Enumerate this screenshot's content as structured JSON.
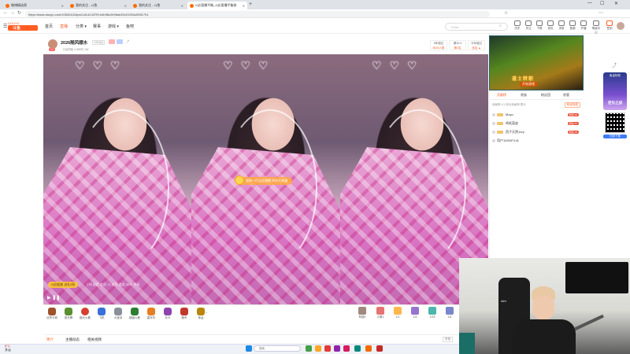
{
  "browser": {
    "tabs": [
      {
        "title": "微博精选视",
        "color": "#ff6a00",
        "active": false
      },
      {
        "title": "我的关注 - 斗鱼",
        "color": "#ff6a00",
        "active": false
      },
      {
        "title": "我的关注 - 斗鱼",
        "color": "#ff6a00",
        "active": false
      },
      {
        "title": "G必直播平衡_G必直播平衡收",
        "color": "#ff6a00",
        "active": true
      }
    ],
    "new_tab_label": "+",
    "window_controls": [
      "—",
      "☐",
      "✕"
    ],
    "url": "https://www.douyu.com/10542441#psCo8-d1437f9-b4b98c2b96ab92c01934c0051701"
  },
  "site": {
    "logo_text": "斗鱼",
    "nav": [
      "首页",
      "直播",
      "分类 ▾",
      "赛事",
      "游戏 ▾",
      "鱼吧"
    ],
    "search_placeholder": "+3 Ar/",
    "header_icons": [
      "历史",
      "关注",
      "下载",
      "钱包",
      "消息",
      "鱼圈",
      "开播",
      "等级中心",
      "签到"
    ]
  },
  "room": {
    "title": "2026随风顺水",
    "room_id": "1054[3]",
    "rank_badge": "14",
    "sub_info": "G必的娃 ▾   555万   1W",
    "stats": [
      {
        "label": "5年超过",
        "value": "8004人数"
      },
      {
        "label": "第33.3",
        "value": "第4名"
      },
      {
        "label": "今年超过",
        "value": "全站 ▲"
      }
    ]
  },
  "video": {
    "gift_message": "送你一打这礼物哦 你好大帅逼",
    "ticker_label": "G必超美 送礼5折",
    "ticker_text": "179 试用 会员 +1 试用 会员 20分 评论",
    "play_glyph": "▶ ❚❚"
  },
  "gifts": [
    {
      "name": "点赞卡券",
      "color": "#a0522d"
    },
    {
      "name": "荧光棒",
      "color": "#5b8f2f"
    },
    {
      "name": "超大火箭",
      "color": "#d4402f"
    },
    {
      "name": "飞机",
      "color": "#3a6ed8"
    },
    {
      "name": "大宝剑",
      "color": "#8a8f99"
    },
    {
      "name": "超级火箭",
      "color": "#2e7d32"
    },
    {
      "name": "嘉年华",
      "color": "#e67e22"
    },
    {
      "name": "办卡",
      "color": "#8e44ad"
    },
    {
      "name": "跑车",
      "color": "#c0392b"
    },
    {
      "name": "幸运",
      "color": "#b8860b"
    },
    {
      "name": "心动",
      "color": "#c2185b"
    },
    {
      "name": "开黑宝藏",
      "color": "#6d4c41"
    }
  ],
  "owned_gifts": [
    {
      "name": "有翅1",
      "color": "#a1887f"
    },
    {
      "name": "小乘1",
      "color": "#e57373"
    },
    {
      "name": "1/1",
      "color": "#ffb74d"
    },
    {
      "name": "1/4",
      "color": "#9575cd"
    },
    {
      "name": "1/15",
      "color": "#4db6ac"
    },
    {
      "name": "1/4",
      "color": "#7986cb"
    }
  ],
  "below_tabs": [
    "简介",
    "主播动态",
    "相关视频"
  ],
  "report_label": "举报",
  "ad": {
    "title": "道士转职",
    "button": "开始游戏"
  },
  "right_panel": {
    "tabs": [
      "贡献榜",
      "贵族",
      "粉丝团",
      "房管"
    ],
    "subtitle": "贡献榜 1/1   粉丝贡献榜 累计",
    "sub_button": "粉丝特权",
    "users": [
      {
        "name": "Moyo",
        "tag": "粉丝 22"
      },
      {
        "name": "鸡毛蒜皮",
        "tag": "粉丝 12"
      },
      {
        "name": "西子天然1ory",
        "tag": "粉丝 18"
      },
      {
        "name": "用户100057141",
        "tag": ""
      }
    ]
  },
  "side": {
    "top_icons": [
      "分享",
      "举报"
    ],
    "ad_title": "鱼油特效",
    "ad_main": "逆光之战",
    "qr_label": "扫码下载"
  },
  "webcam": {
    "jersey_text": "Aim"
  },
  "taskbar": {
    "temp": "8°C",
    "weather": "多云",
    "search_placeholder": "搜索",
    "icons": [
      "#1e88e5",
      "#43a047",
      "#f9a825",
      "#e53935",
      "#8e24aa",
      "#d81b60",
      "#00897b",
      "#ef6c00"
    ]
  }
}
